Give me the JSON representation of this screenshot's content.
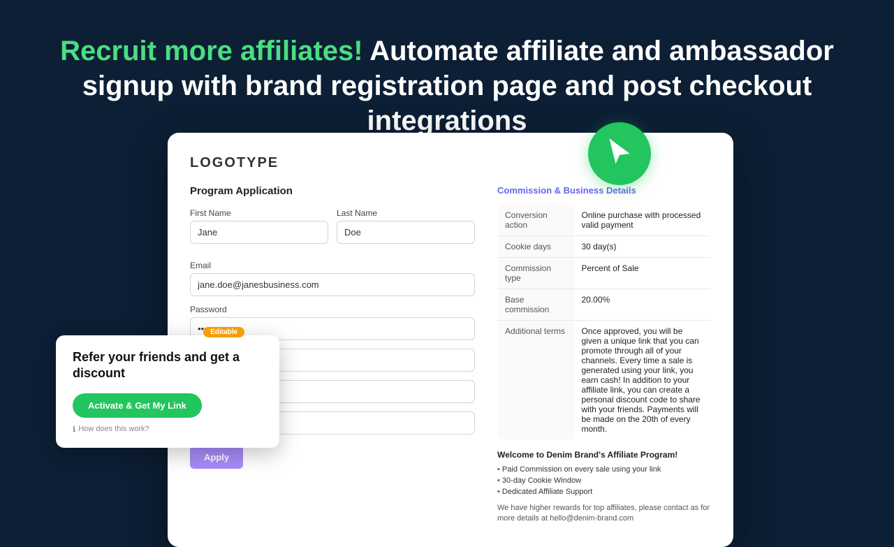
{
  "hero": {
    "green_text": "Recruit more affiliates!",
    "white_text": " Automate affiliate and ambassador signup with brand registration page and post checkout integrations"
  },
  "card": {
    "logotype": "LOGOTYPE",
    "form": {
      "title": "Program Application",
      "first_name_label": "First Name",
      "first_name_value": "Jane",
      "last_name_label": "Last Name",
      "last_name_value": "Doe",
      "email_label": "Email",
      "email_value": "jane.doe@janesbusiness.com",
      "password_label": "Password",
      "password_value": "••••••••",
      "apply_label": "Apply"
    },
    "commission": {
      "title": "Commission & Business Details",
      "rows": [
        {
          "label": "Conversion action",
          "value": "Online purchase with processed valid payment"
        },
        {
          "label": "Cookie days",
          "value": "30 day(s)"
        },
        {
          "label": "Commission type",
          "value": "Percent of Sale"
        },
        {
          "label": "Base commission",
          "value": "20.00%"
        },
        {
          "label": "Additional terms",
          "value": "Once approved, you will be given a unique link that you can promote through all of your channels. Every time a sale is generated using your link, you earn cash! In addition to your affiliate link, you can create a personal discount code to share with your friends. Payments will be made on the 20th of every month."
        }
      ],
      "welcome_title": "Welcome to Denim Brand's Affiliate Program!",
      "bullets": [
        "Paid Commission on every sale using your link",
        "30-day Cookie Window",
        "Dedicated Affiliate Support"
      ],
      "footer_note": "We have higher rewards for top affiliates, please contact as for more details at hello@denim-brand.com"
    }
  },
  "referral": {
    "editable_badge": "Editable",
    "headline": "Refer your friends and get a discount",
    "activate_label": "Activate & Get My Link",
    "how_label": "How does this work?"
  }
}
